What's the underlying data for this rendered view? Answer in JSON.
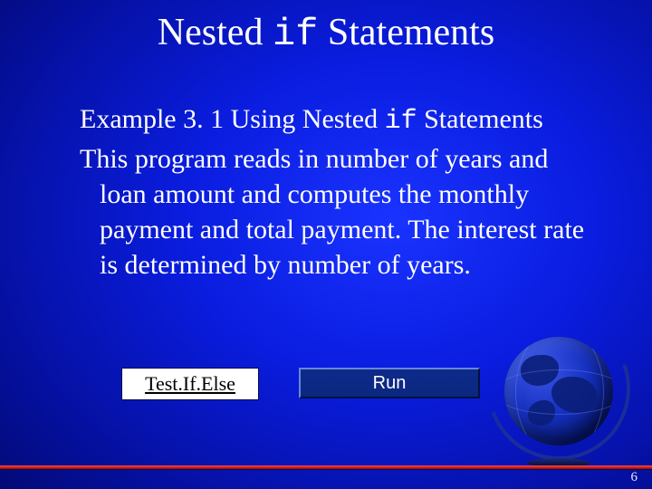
{
  "title": {
    "pre": "Nested ",
    "mono": "if",
    "post": " Statements"
  },
  "example_line": {
    "pre": "Example 3. 1 Using Nested ",
    "mono": "if",
    "post": " Statements"
  },
  "description": "This program reads in number of years and loan amount and computes the monthly payment and total payment. The interest rate is determined by number of years.",
  "link_label": "Test.If.Else",
  "run_label": "Run",
  "page_number": "6"
}
